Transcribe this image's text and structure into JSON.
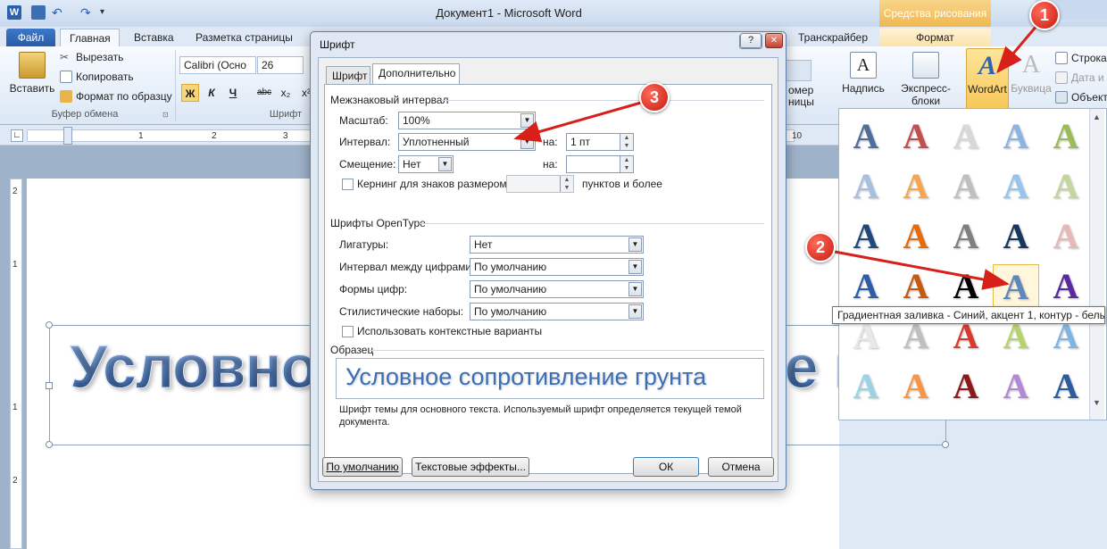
{
  "window": {
    "title": "Документ1 - Microsoft Word",
    "contextual_group": "Средства рисования"
  },
  "tabs": {
    "file": "Файл",
    "home": "Главная",
    "insert": "Вставка",
    "layout": "Разметка страницы",
    "transcriber": "Транскрайбер",
    "format": "Формат"
  },
  "ribbon": {
    "clipboard": {
      "paste": "Вставить",
      "cut": "Вырезать",
      "copy": "Копировать",
      "format_painter": "Формат по образцу",
      "group_label": "Буфер обмена"
    },
    "font": {
      "font_name": "Calibri (Осно",
      "font_size": "26",
      "group_label": "Шрифт",
      "bold": "Ж",
      "italic": "К",
      "underline": "Ч",
      "strike": "abc",
      "subscript": "x₂",
      "superscript": "x²"
    },
    "partial": {
      "number_a": "омер",
      "number_b": "ницы"
    },
    "text_group": {
      "textbox": "Надпись",
      "quick_parts": "Экспресс-блоки",
      "wordart": "WordArt",
      "dropcap": "Буквица",
      "signature_line": "Строка",
      "date_time": "Дата и",
      "object": "Объект"
    }
  },
  "ruler": {
    "h_numbers": [
      "1",
      "2",
      "3"
    ],
    "h_right": "10",
    "v_numbers": [
      "2",
      "1",
      "1",
      "2"
    ]
  },
  "document": {
    "wordart_text": "Условное сопротивление грунта"
  },
  "dialog": {
    "title": "Шрифт",
    "help": "?",
    "close": "✕",
    "tab_font": "Шрифт",
    "tab_advanced": "Дополнительно",
    "spacing_section": "Межзнаковый интервал",
    "scale_label": "Масштаб:",
    "scale_value": "100%",
    "spacing_label": "Интервал:",
    "spacing_value": "Уплотненный",
    "by_label": "на:",
    "spacing_by_value": "1 пт",
    "position_label": "Смещение:",
    "position_value": "Нет",
    "position_by_label": "на:",
    "position_by_value": "",
    "kerning_label": "Кернинг для знаков размером:",
    "kerning_value": "",
    "kerning_suffix": "пунктов и более",
    "opentype_section": "Шрифты OpenType",
    "ligatures_label": "Лигатуры:",
    "ligatures_value": "Нет",
    "number_spacing_label": "Интервал между цифрами:",
    "number_spacing_value": "По умолчанию",
    "number_forms_label": "Формы цифр:",
    "number_forms_value": "По умолчанию",
    "stylistic_sets_label": "Стилистические наборы:",
    "stylistic_sets_value": "По умолчанию",
    "contextual_alternates_label": "Использовать контекстные варианты",
    "preview_section": "Образец",
    "preview_text": "Условное сопротивление грунта",
    "preview_note_1": "Шрифт темы для основного текста. Используемый шрифт определяется текущей темой",
    "preview_note_2": "документа.",
    "btn_default": "По умолчанию",
    "btn_text_effects": "Текстовые эффекты...",
    "btn_ok": "ОК",
    "btn_cancel": "Отмена"
  },
  "gallery": {
    "glyph": "A",
    "tooltip": "Градиентная заливка - Синий, акцент 1, контур - белый",
    "rows": [
      [
        "#4f6f9a",
        "#c0504d",
        "#d8d8d8",
        "#8db3e2",
        "#9bbb59"
      ],
      [
        "#a8c0e0",
        "#f6a552",
        "#bfbfbf",
        "#95c4ee",
        "#c3d69b"
      ],
      [
        "#1f497d",
        "#e46c0a",
        "#7f7f7f",
        "#17375e",
        "#e6b9b8"
      ],
      [
        "#2e5fa6",
        "#c55a11",
        "#000000",
        "#5e87bf",
        "#5b2a9e"
      ],
      [
        "#e8e8e8",
        "#bfbfbf",
        "#d83a2f",
        "#b6d36a",
        "#7fb4e6"
      ],
      [
        "#9ad3e6",
        "#f79646",
        "#8b1a1a",
        "#b18ad6",
        "#2a5c9e"
      ]
    ]
  },
  "callouts": [
    "1",
    "2",
    "3"
  ],
  "colors": {
    "accent_blue": "#2b579a",
    "callout_red": "#d8201a"
  }
}
